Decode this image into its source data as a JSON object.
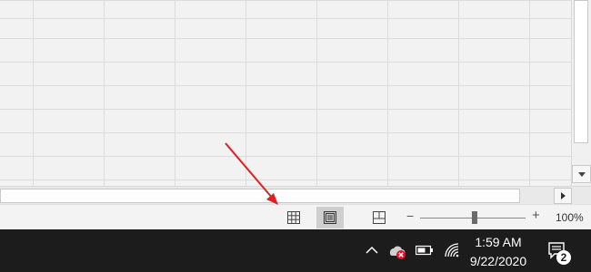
{
  "status_bar": {
    "views": [
      {
        "id": "normal",
        "icon": "grid-icon",
        "active": false
      },
      {
        "id": "page-layout",
        "icon": "page-layout-icon",
        "active": true
      },
      {
        "id": "page-break-preview",
        "icon": "page-break-icon",
        "active": false
      }
    ],
    "zoom_minus": "−",
    "zoom_plus": "+",
    "zoom_level": "100%"
  },
  "annotation": {
    "color": "#e02020",
    "icon": "arrow-icon"
  },
  "taskbar": {
    "tray_icons": [
      "chevron-up-icon",
      "onedrive-error-icon",
      "battery-icon",
      "wifi-icon"
    ],
    "time": "1:59 AM",
    "date": "9/22/2020",
    "notification_count": "2"
  },
  "colors": {
    "sheet_bg": "#f2f2f2",
    "gridline": "#dcdcdc",
    "taskbar_bg": "#1c1c1c",
    "error_red": "#e81123"
  }
}
